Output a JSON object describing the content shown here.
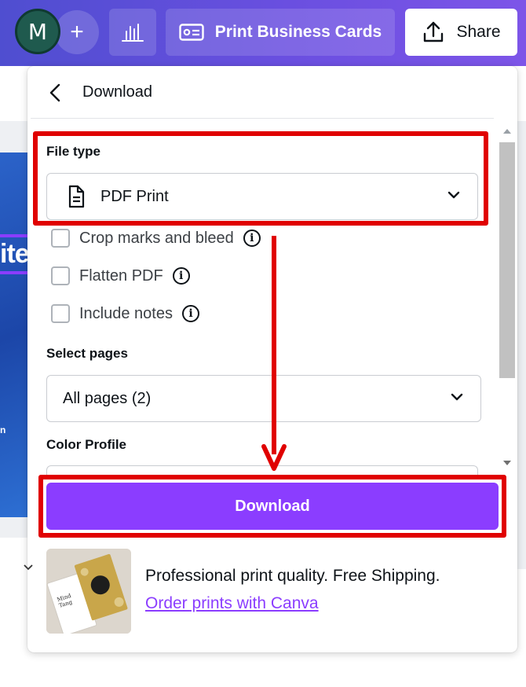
{
  "topbar": {
    "avatar_initial": "M",
    "plus_symbol": "+",
    "print_label": "Print Business Cards",
    "share_label": "Share"
  },
  "canvas": {
    "partial_text": "ite",
    "partial_small": "n"
  },
  "panel": {
    "title": "Download",
    "file_type": {
      "label": "File type",
      "value": "PDF Print"
    },
    "options": [
      {
        "label": "Crop marks and bleed",
        "checked": false
      },
      {
        "label": "Flatten PDF",
        "checked": false
      },
      {
        "label": "Include notes",
        "checked": false
      }
    ],
    "select_pages": {
      "label": "Select pages",
      "value": "All pages (2)"
    },
    "color_profile": {
      "label": "Color Profile"
    },
    "download_label": "Download",
    "promo": {
      "text": "Professional print quality. Free Shipping.",
      "link": "Order prints with Canva"
    }
  },
  "colors": {
    "topbar_start": "#4f4ed0",
    "topbar_end": "#7d55e8",
    "accent_purple": "#8b3dff",
    "annotation_red": "#e00000"
  }
}
